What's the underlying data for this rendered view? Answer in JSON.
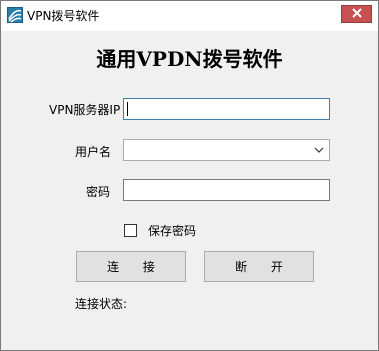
{
  "window": {
    "title": "VPN拨号软件",
    "icon": "app-icon",
    "close_icon": "close-icon"
  },
  "form": {
    "heading": "通用VPDN拨号软件",
    "server_ip": {
      "label": "VPN服务器IP",
      "value": ""
    },
    "username": {
      "label": "用户名",
      "value": ""
    },
    "password": {
      "label": "密码",
      "value": ""
    },
    "save_password": {
      "label": "保存密码",
      "checked": false
    }
  },
  "buttons": {
    "connect": "连 接",
    "disconnect": "断 开"
  },
  "status": {
    "label": "连接状态:",
    "value": ""
  },
  "colors": {
    "close_button": "#c75050",
    "focus_border": "#3c7fb1"
  }
}
